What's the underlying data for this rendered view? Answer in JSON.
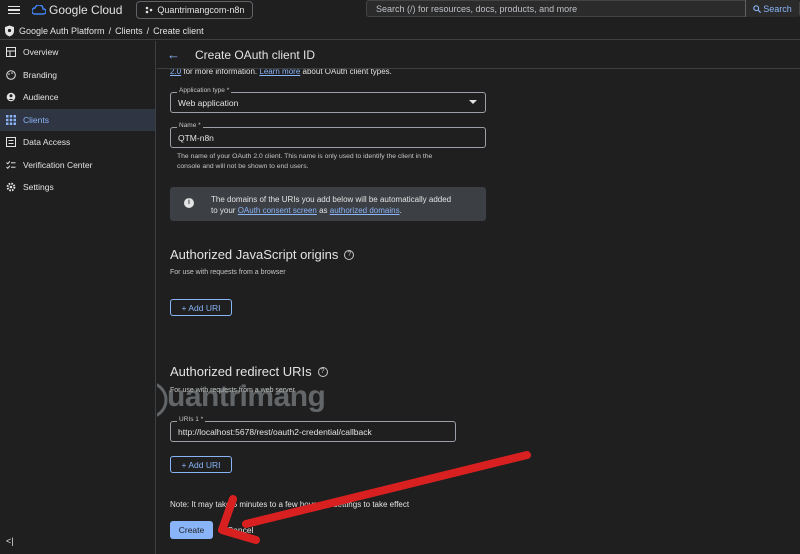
{
  "topbar": {
    "brand": "Google Cloud",
    "project": "Quantrimangcom-n8n",
    "search_placeholder": "Search (/) for resources, docs, products, and more",
    "search_button": "Search"
  },
  "breadcrumb": {
    "root": "Google Auth Platform",
    "sep1": "/",
    "clients": "Clients",
    "sep2": "/",
    "current": "Create client"
  },
  "sidebar": {
    "items": [
      {
        "label": "Overview",
        "icon": "dashboard-icon"
      },
      {
        "label": "Branding",
        "icon": "palette-icon"
      },
      {
        "label": "Audience",
        "icon": "person-icon"
      },
      {
        "label": "Clients",
        "icon": "grid-icon"
      },
      {
        "label": "Data Access",
        "icon": "list-icon"
      },
      {
        "label": "Verification Center",
        "icon": "check-list-icon"
      },
      {
        "label": "Settings",
        "icon": "gear-icon"
      }
    ],
    "active": "Clients",
    "collapse": "<|"
  },
  "page": {
    "title": "Create OAuth client ID",
    "info_prefix": "2.0",
    "info_mid": " for more information. ",
    "info_link": "Learn more",
    "info_suffix": " about OAuth client types."
  },
  "form": {
    "app_type_label": "Application type *",
    "app_type_value": "Web application",
    "name_label": "Name *",
    "name_value": "QTM-n8n",
    "name_hint_1": "The name of your OAuth 2.0 client. This name is only used to identify the client in the",
    "name_hint_2": "console and will not be shown to end users.",
    "banner_1": "The domains of the URIs you add below will be automatically added",
    "banner_2_prefix": "to your ",
    "banner_link1": "OAuth consent screen",
    "banner_mid": " as ",
    "banner_link2": "authorized domains",
    "banner_end": "."
  },
  "js_origins": {
    "title": "Authorized JavaScript origins",
    "subtitle": "For use with requests from a browser",
    "add_label": "+ Add URI"
  },
  "redirect": {
    "title": "Authorized redirect URIs",
    "subtitle": "For use with requests from a web server",
    "uri_label": "URIs 1 *",
    "uri_value": "http://localhost:5678/rest/oauth2-credential/callback",
    "add_label": "+ Add URI"
  },
  "footer": {
    "note": "Note: It may take 5 minutes to a few hours for settings to take effect",
    "create": "Create",
    "cancel": "Cancel"
  },
  "watermark": "uantrimang",
  "colors": {
    "accent": "#8ab4f8",
    "arrow": "#d92020",
    "bg": "#1f1f1f"
  }
}
